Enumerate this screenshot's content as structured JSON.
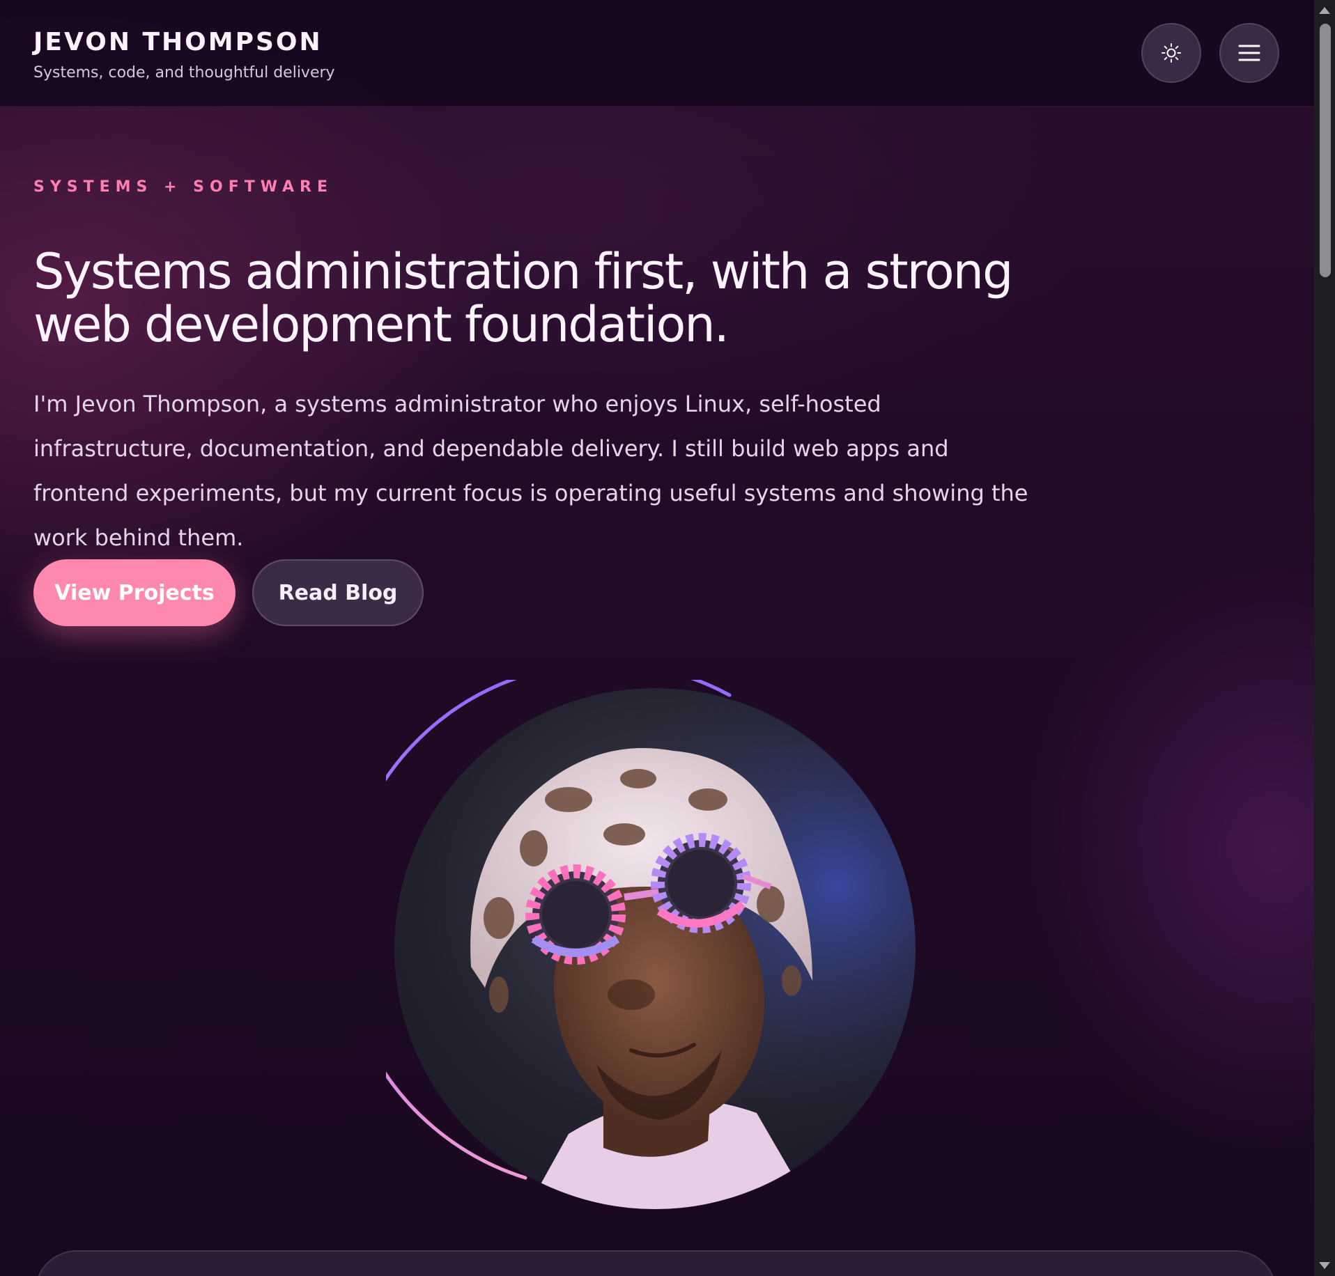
{
  "header": {
    "brand_name": "JEVON THOMPSON",
    "tagline": "Systems, code, and thoughtful delivery",
    "theme_toggle_icon": "sun-icon",
    "menu_icon": "hamburger-menu-icon"
  },
  "hero": {
    "eyebrow": "SYSTEMS + SOFTWARE",
    "title": "Systems administration first, with a strong web development foundation.",
    "intro": "I'm Jevon Thompson, a systems administrator who enjoys Linux, self-hosted infrastructure, documentation, and dependable delivery. I still build web apps and frontend experiments, but my current focus is operating useful systems and showing the work behind them.",
    "primary_cta": "View Projects",
    "secondary_cta": "Read Blog"
  },
  "colors": {
    "accent_pink": "#ff89ae",
    "eyebrow_pink": "#ff7fb0",
    "ring_purple": "#9b6bff",
    "ring_pink": "#f08ad8",
    "background": "#1a0820"
  }
}
